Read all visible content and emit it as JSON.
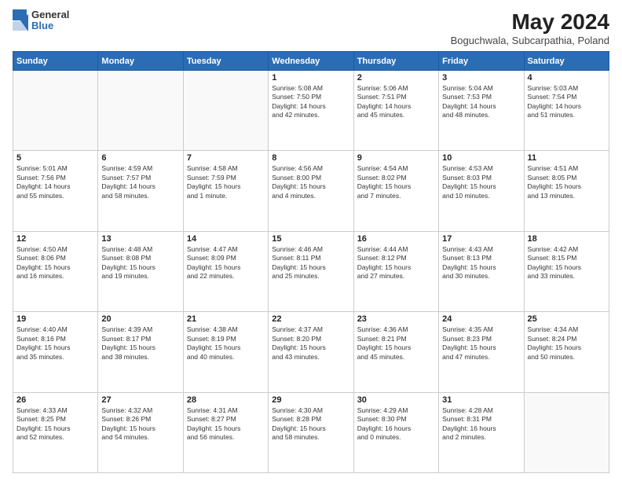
{
  "header": {
    "logo_general": "General",
    "logo_blue": "Blue",
    "month_year": "May 2024",
    "location": "Boguchwala, Subcarpathia, Poland"
  },
  "weekdays": [
    "Sunday",
    "Monday",
    "Tuesday",
    "Wednesday",
    "Thursday",
    "Friday",
    "Saturday"
  ],
  "weeks": [
    [
      {
        "day": "",
        "info": ""
      },
      {
        "day": "",
        "info": ""
      },
      {
        "day": "",
        "info": ""
      },
      {
        "day": "1",
        "info": "Sunrise: 5:08 AM\nSunset: 7:50 PM\nDaylight: 14 hours\nand 42 minutes."
      },
      {
        "day": "2",
        "info": "Sunrise: 5:06 AM\nSunset: 7:51 PM\nDaylight: 14 hours\nand 45 minutes."
      },
      {
        "day": "3",
        "info": "Sunrise: 5:04 AM\nSunset: 7:53 PM\nDaylight: 14 hours\nand 48 minutes."
      },
      {
        "day": "4",
        "info": "Sunrise: 5:03 AM\nSunset: 7:54 PM\nDaylight: 14 hours\nand 51 minutes."
      }
    ],
    [
      {
        "day": "5",
        "info": "Sunrise: 5:01 AM\nSunset: 7:56 PM\nDaylight: 14 hours\nand 55 minutes."
      },
      {
        "day": "6",
        "info": "Sunrise: 4:59 AM\nSunset: 7:57 PM\nDaylight: 14 hours\nand 58 minutes."
      },
      {
        "day": "7",
        "info": "Sunrise: 4:58 AM\nSunset: 7:59 PM\nDaylight: 15 hours\nand 1 minute."
      },
      {
        "day": "8",
        "info": "Sunrise: 4:56 AM\nSunset: 8:00 PM\nDaylight: 15 hours\nand 4 minutes."
      },
      {
        "day": "9",
        "info": "Sunrise: 4:54 AM\nSunset: 8:02 PM\nDaylight: 15 hours\nand 7 minutes."
      },
      {
        "day": "10",
        "info": "Sunrise: 4:53 AM\nSunset: 8:03 PM\nDaylight: 15 hours\nand 10 minutes."
      },
      {
        "day": "11",
        "info": "Sunrise: 4:51 AM\nSunset: 8:05 PM\nDaylight: 15 hours\nand 13 minutes."
      }
    ],
    [
      {
        "day": "12",
        "info": "Sunrise: 4:50 AM\nSunset: 8:06 PM\nDaylight: 15 hours\nand 16 minutes."
      },
      {
        "day": "13",
        "info": "Sunrise: 4:48 AM\nSunset: 8:08 PM\nDaylight: 15 hours\nand 19 minutes."
      },
      {
        "day": "14",
        "info": "Sunrise: 4:47 AM\nSunset: 8:09 PM\nDaylight: 15 hours\nand 22 minutes."
      },
      {
        "day": "15",
        "info": "Sunrise: 4:46 AM\nSunset: 8:11 PM\nDaylight: 15 hours\nand 25 minutes."
      },
      {
        "day": "16",
        "info": "Sunrise: 4:44 AM\nSunset: 8:12 PM\nDaylight: 15 hours\nand 27 minutes."
      },
      {
        "day": "17",
        "info": "Sunrise: 4:43 AM\nSunset: 8:13 PM\nDaylight: 15 hours\nand 30 minutes."
      },
      {
        "day": "18",
        "info": "Sunrise: 4:42 AM\nSunset: 8:15 PM\nDaylight: 15 hours\nand 33 minutes."
      }
    ],
    [
      {
        "day": "19",
        "info": "Sunrise: 4:40 AM\nSunset: 8:16 PM\nDaylight: 15 hours\nand 35 minutes."
      },
      {
        "day": "20",
        "info": "Sunrise: 4:39 AM\nSunset: 8:17 PM\nDaylight: 15 hours\nand 38 minutes."
      },
      {
        "day": "21",
        "info": "Sunrise: 4:38 AM\nSunset: 8:19 PM\nDaylight: 15 hours\nand 40 minutes."
      },
      {
        "day": "22",
        "info": "Sunrise: 4:37 AM\nSunset: 8:20 PM\nDaylight: 15 hours\nand 43 minutes."
      },
      {
        "day": "23",
        "info": "Sunrise: 4:36 AM\nSunset: 8:21 PM\nDaylight: 15 hours\nand 45 minutes."
      },
      {
        "day": "24",
        "info": "Sunrise: 4:35 AM\nSunset: 8:23 PM\nDaylight: 15 hours\nand 47 minutes."
      },
      {
        "day": "25",
        "info": "Sunrise: 4:34 AM\nSunset: 8:24 PM\nDaylight: 15 hours\nand 50 minutes."
      }
    ],
    [
      {
        "day": "26",
        "info": "Sunrise: 4:33 AM\nSunset: 8:25 PM\nDaylight: 15 hours\nand 52 minutes."
      },
      {
        "day": "27",
        "info": "Sunrise: 4:32 AM\nSunset: 8:26 PM\nDaylight: 15 hours\nand 54 minutes."
      },
      {
        "day": "28",
        "info": "Sunrise: 4:31 AM\nSunset: 8:27 PM\nDaylight: 15 hours\nand 56 minutes."
      },
      {
        "day": "29",
        "info": "Sunrise: 4:30 AM\nSunset: 8:28 PM\nDaylight: 15 hours\nand 58 minutes."
      },
      {
        "day": "30",
        "info": "Sunrise: 4:29 AM\nSunset: 8:30 PM\nDaylight: 16 hours\nand 0 minutes."
      },
      {
        "day": "31",
        "info": "Sunrise: 4:28 AM\nSunset: 8:31 PM\nDaylight: 16 hours\nand 2 minutes."
      },
      {
        "day": "",
        "info": ""
      }
    ]
  ]
}
